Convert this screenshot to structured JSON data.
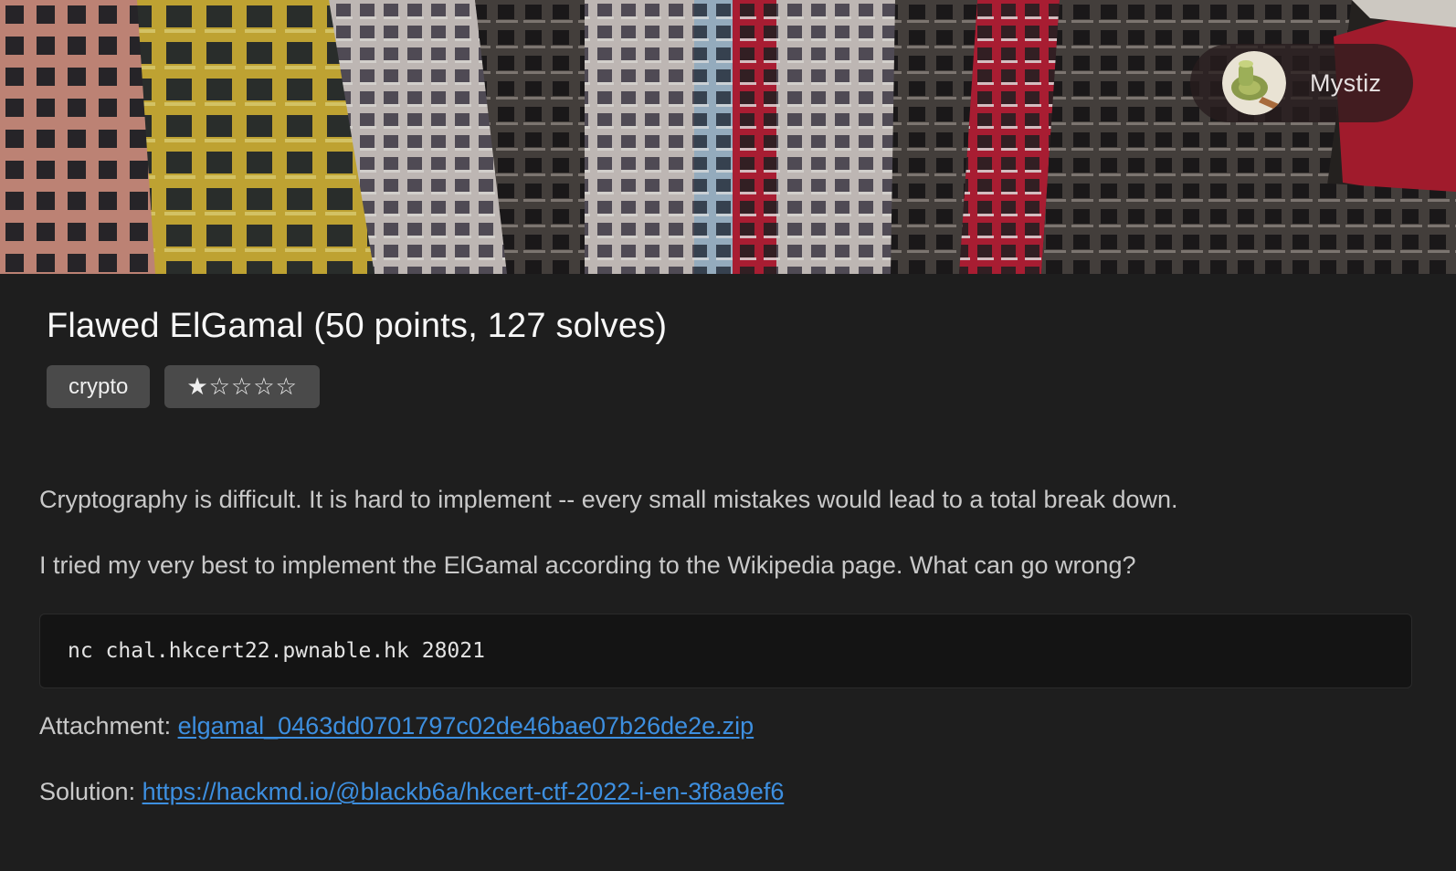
{
  "author": {
    "name": "Mystiz",
    "avatar_icon": "avatar-thread-spool-icon"
  },
  "challenge": {
    "title": "Flawed ElGamal (50 points, 127 solves)",
    "tags": [
      "crypto"
    ],
    "difficulty_stars": "★☆☆☆☆",
    "difficulty_rating": 1,
    "difficulty_max": 5
  },
  "description": {
    "p1": "Cryptography is difficult. It is hard to implement -- every small mistakes would lead to a total break down.",
    "p2": "I tried my very best to implement the ElGamal according to the Wikipedia page. What can go wrong?",
    "command": "nc chal.hkcert22.pwnable.hk 28021"
  },
  "attachment": {
    "label": "Attachment: ",
    "link_text": "elgamal_0463dd0701797c02de46bae07b26de2e.zip"
  },
  "solution": {
    "label": "Solution: ",
    "link_text": "https://hackmd.io/@blackb6a/hkcert-ctf-2022-i-en-3f8a9ef6"
  },
  "colors": {
    "background": "#1e1e1e",
    "link": "#3d8fe0",
    "tag_bg": "#4a4a4a",
    "code_bg": "#141414"
  }
}
